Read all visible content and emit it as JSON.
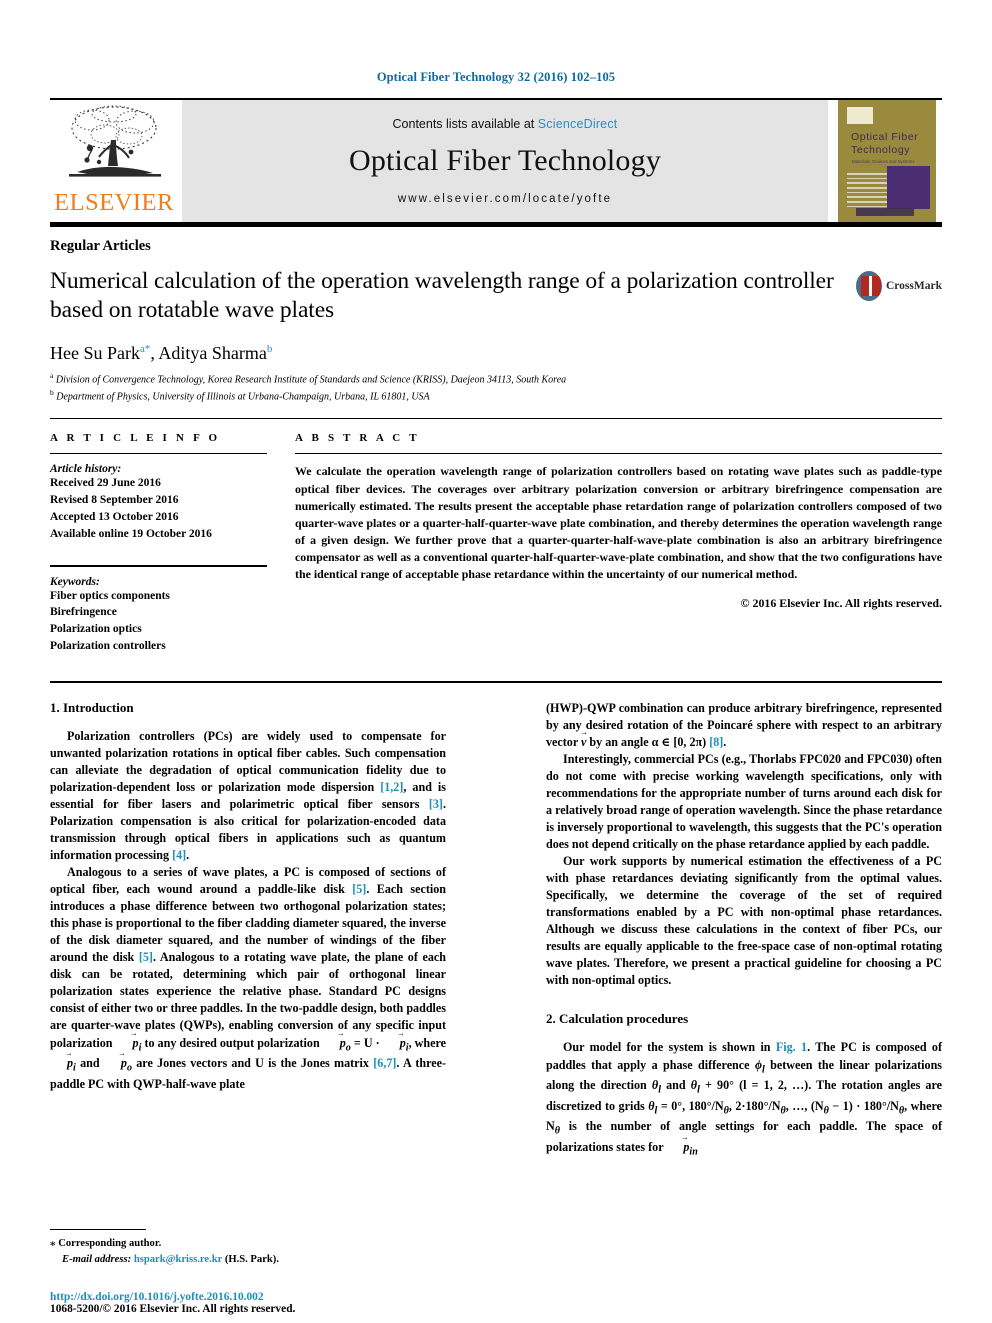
{
  "running_head": "Optical Fiber Technology 32 (2016) 102–105",
  "masthead": {
    "contents_prefix": "Contents lists available at ",
    "sciencedirect": "ScienceDirect",
    "journal_name": "Optical Fiber Technology",
    "journal_url": "www.elsevier.com/locate/yofte",
    "publisher_wordmark": "ELSEVIER",
    "cover": {
      "title_line1": "Optical  Fiber",
      "title_line2": "Technology",
      "subtitle": "Materials, Devices and Systems"
    }
  },
  "article": {
    "section_label": "Regular Articles",
    "title": "Numerical calculation of the operation wavelength range of a polarization controller based on rotatable wave plates",
    "crossmark_label": "CrossMark",
    "authors": [
      {
        "name": "Hee Su Park",
        "sup": "a",
        "star": "*"
      },
      {
        "name": "Aditya Sharma",
        "sup": "b"
      }
    ],
    "affiliations": [
      {
        "marker": "a",
        "text": "Division of Convergence Technology, Korea Research Institute of Standards and Science (KRISS), Daejeon 34113, South Korea"
      },
      {
        "marker": "b",
        "text": "Department of Physics, University of Illinois at Urbana-Champaign, Urbana, IL 61801, USA"
      }
    ]
  },
  "info": {
    "heading": "A R T I C L E    I N F O",
    "history_label": "Article history:",
    "history": [
      "Received 29 June 2016",
      "Revised 8 September 2016",
      "Accepted 13 October 2016",
      "Available online 19 October 2016"
    ],
    "keywords_label": "Keywords:",
    "keywords": [
      "Fiber optics components",
      "Birefringence",
      "Polarization optics",
      "Polarization controllers"
    ]
  },
  "abstract": {
    "heading": "A B S T R A C T",
    "text": "We calculate the operation wavelength range of polarization controllers based on rotating wave plates such as paddle-type optical fiber devices. The coverages over arbitrary polarization conversion or arbitrary birefringence compensation are numerically estimated. The results present the acceptable phase retardation range of polarization controllers composed of two quarter-wave plates or a quarter-half-quarter-wave plate combination, and thereby determines the operation wavelength range of a given design. We further prove that a quarter-quarter-half-wave-plate combination is also an arbitrary birefringence compensator as well as a conventional quarter-half-quarter-wave-plate combination, and show that the two configurations have the identical range of acceptable phase retardance within the uncertainty of our numerical method.",
    "copyright": "© 2016 Elsevier Inc. All rights reserved."
  },
  "body": {
    "left": {
      "section1_heading": "1. Introduction",
      "p1_a": "Polarization controllers (PCs) are widely used to compensate for unwanted polarization rotations in optical fiber cables. Such compensation can alleviate the degradation of optical communication fidelity due to polarization-dependent loss or polarization mode dispersion ",
      "p1_cit1": "[1,2]",
      "p1_b": ", and is essential for fiber lasers and polarimetric optical fiber sensors ",
      "p1_cit2": "[3]",
      "p1_c": ". Polarization compensation is also critical for polarization-encoded data transmission through optical fibers in applications such as quantum information processing ",
      "p1_cit3": "[4]",
      "p1_d": ".",
      "p2_a": "Analogous to a series of wave plates, a PC is composed of sections of optical fiber, each wound around a paddle-like disk ",
      "p2_cit1": "[5]",
      "p2_b": ". Each section introduces a phase difference between two orthogonal polarization states; this phase is proportional to the fiber cladding diameter squared, the inverse of the disk diameter squared, and the number of windings of the fiber around the disk ",
      "p2_cit2": "[5]",
      "p2_c": ". Analogous to a rotating wave plate, the plane of each disk can be rotated, determining which pair of orthogonal linear polarization states experience the relative phase. Standard PC designs consist of either two or three paddles. In the two-paddle design, both paddles are quarter-wave plates (QWPs), enabling conversion of any specific input polarization ",
      "p2_math1": "p",
      "p2_math1_sub": "i",
      "p2_d": " to any desired output polarization ",
      "p2_math2": "p",
      "p2_math2_sub": "o",
      "p2_e": " = U · ",
      "p2_math3": "p",
      "p2_math3_sub": "i",
      "p2_f": ", where ",
      "p2_math4": "p",
      "p2_math4_sub": "i",
      "p2_g": " and ",
      "p2_math5": "p",
      "p2_math5_sub": "o",
      "p2_h": " are Jones vectors and U is the Jones matrix ",
      "p2_cit3": "[6,7]",
      "p2_i": ". A three-paddle PC with QWP-half-wave plate"
    },
    "right": {
      "p3_a": "(HWP)-QWP combination can produce arbitrary birefringence, represented by any desired rotation of the Poincaré sphere with respect to an arbitrary vector ",
      "p3_vec": "v",
      "p3_b": " by an angle α ∈ [0, 2π) ",
      "p3_cit1": "[8]",
      "p3_c": ".",
      "p4": "Interestingly, commercial PCs (e.g., Thorlabs FPC020 and FPC030) often do not come with precise working wavelength specifications, only with recommendations for the appropriate number of turns around each disk for a relatively broad range of operation wavelength. Since the phase retardance is inversely proportional to wavelength, this suggests that the PC's operation does not depend critically on the phase retardance applied by each paddle.",
      "p5": "Our work supports by numerical estimation the effectiveness of a PC with phase retardances deviating significantly from the optimal values. Specifically, we determine the coverage of the set of required transformations enabled by a PC with non-optimal phase retardances. Although we discuss these calculations in the context of fiber PCs, our results are equally applicable to the free-space case of non-optimal rotating wave plates. Therefore, we present a practical guideline for choosing a PC with non-optimal optics.",
      "section2_heading": "2. Calculation procedures",
      "p6_a": "Our model for the system is shown in ",
      "p6_figref": "Fig. 1",
      "p6_b": ". The PC is composed of paddles that apply a phase difference ",
      "p6_m1": "ϕ",
      "p6_m1_sub": "l",
      "p6_c": " between the linear polarizations along the direction ",
      "p6_m2": "θ",
      "p6_m2_sub": "l",
      "p6_d": " and ",
      "p6_m3": "θ",
      "p6_m3_sub": "l",
      "p6_e": " + 90° (l = 1, 2, …). The rotation angles are discretized to grids ",
      "p6_m4": "θ",
      "p6_m4_sub": "l",
      "p6_f": " = 0°, 180°/N",
      "p6_m5": "θ",
      "p6_g": ", 2·180°/N",
      "p6_m6": "θ",
      "p6_h": ", …, (N",
      "p6_m7": "θ",
      "p6_i": " − 1) · 180°/N",
      "p6_m8": "θ",
      "p6_j": ", where N",
      "p6_m9": "θ",
      "p6_k": " is the number of angle settings for each paddle. The space of polarizations states for ",
      "p6_vec": "p",
      "p6_vec_sub": "in"
    }
  },
  "footnote": {
    "corresponding_marker": "⁎",
    "corresponding_text": "Corresponding author.",
    "email_label": "E-mail address:",
    "email": "hspark@kriss.re.kr",
    "email_owner": "(H.S. Park)."
  },
  "footer": {
    "doi": "http://dx.doi.org/10.1016/j.yofte.2016.10.002",
    "issn_line": "1068-5200/© 2016 Elsevier Inc. All rights reserved."
  },
  "colors": {
    "link_blue": "#1c8fb8",
    "header_blue": "#0b6ba0",
    "elsevier_orange": "#ef7d1a",
    "masthead_grey": "#e4e4e4"
  }
}
